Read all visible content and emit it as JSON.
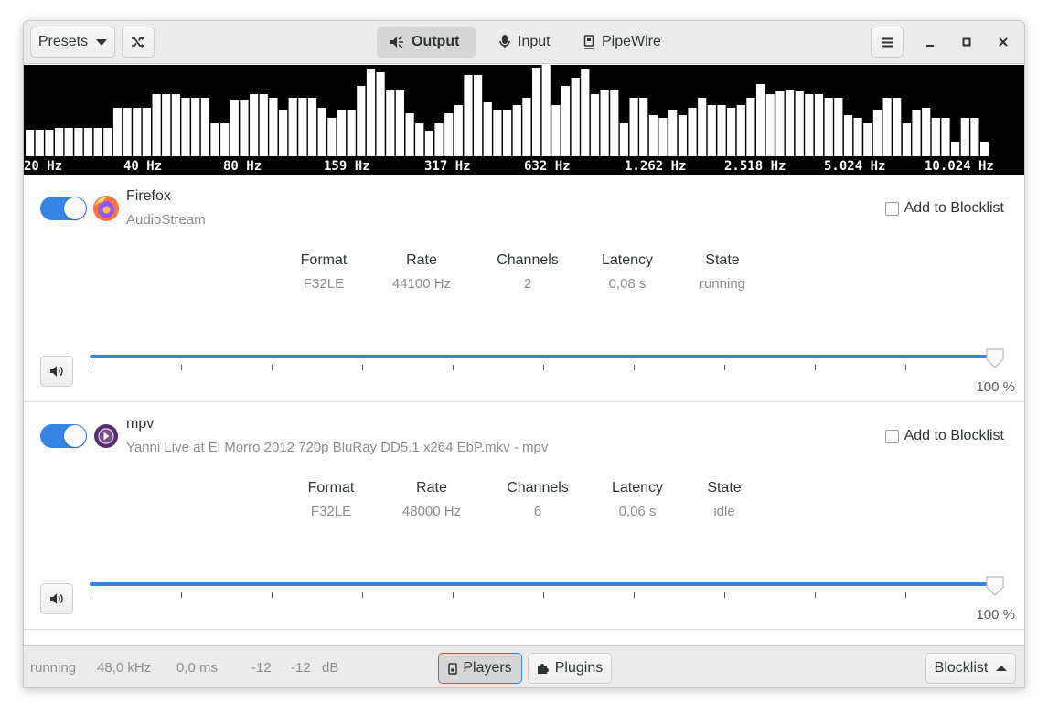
{
  "header": {
    "presets_label": "Presets",
    "tabs": [
      {
        "label": "Output",
        "icon": "speaker-icon",
        "active": true
      },
      {
        "label": "Input",
        "icon": "microphone-icon",
        "active": false
      },
      {
        "label": "PipeWire",
        "icon": "pipewire-icon",
        "active": false
      }
    ]
  },
  "spectrum": {
    "frequency_labels": [
      "20 Hz",
      "40 Hz",
      "80 Hz",
      "159 Hz",
      "317 Hz",
      "632 Hz",
      "1.262 Hz",
      "2.518 Hz",
      "5.024 Hz",
      "10.024 Hz"
    ],
    "levels": [
      0.29,
      0.29,
      0.29,
      0.31,
      0.31,
      0.31,
      0.31,
      0.31,
      0.31,
      0.53,
      0.53,
      0.53,
      0.53,
      0.68,
      0.68,
      0.68,
      0.64,
      0.64,
      0.64,
      0.36,
      0.36,
      0.62,
      0.62,
      0.68,
      0.68,
      0.64,
      0.51,
      0.64,
      0.64,
      0.64,
      0.53,
      0.42,
      0.51,
      0.51,
      0.77,
      0.95,
      0.92,
      0.73,
      0.73,
      0.47,
      0.36,
      0.28,
      0.36,
      0.47,
      0.56,
      0.89,
      0.89,
      0.59,
      0.51,
      0.51,
      0.56,
      0.64,
      0.97,
      1.0,
      0.56,
      0.77,
      0.86,
      0.95,
      0.68,
      0.73,
      0.73,
      0.36,
      0.64,
      0.64,
      0.45,
      0.42,
      0.51,
      0.45,
      0.53,
      0.64,
      0.56,
      0.56,
      0.53,
      0.56,
      0.64,
      0.79,
      0.68,
      0.71,
      0.73,
      0.71,
      0.68,
      0.68,
      0.64,
      0.64,
      0.45,
      0.42,
      0.36,
      0.51,
      0.64,
      0.64,
      0.36,
      0.51,
      0.53,
      0.42,
      0.42,
      0.16,
      0.42,
      0.42,
      0.16
    ],
    "bar_color": "#ffffff",
    "background": "#000000"
  },
  "streams": [
    {
      "enabled": true,
      "app_name": "Firefox",
      "media_name": "AudioStream",
      "icon": "firefox-icon",
      "blocklist_label": "Add to Blocklist",
      "info": [
        {
          "label": "Format",
          "value": "F32LE"
        },
        {
          "label": "Rate",
          "value": "44100 Hz"
        },
        {
          "label": "Channels",
          "value": "2"
        },
        {
          "label": "Latency",
          "value": "0,08 s"
        },
        {
          "label": "State",
          "value": "running"
        }
      ],
      "volume_text": "100 %",
      "volume": 1.0
    },
    {
      "enabled": true,
      "app_name": "mpv",
      "media_name": "Yanni Live at El Morro 2012 720p BluRay DD5.1 x264 EbP.mkv - mpv",
      "icon": "mpv-icon",
      "blocklist_label": "Add to Blocklist",
      "info": [
        {
          "label": "Format",
          "value": "F32LE"
        },
        {
          "label": "Rate",
          "value": "48000 Hz"
        },
        {
          "label": "Channels",
          "value": "6"
        },
        {
          "label": "Latency",
          "value": "0,06 s"
        },
        {
          "label": "State",
          "value": "idle"
        }
      ],
      "volume_text": "100 %",
      "volume": 1.0
    }
  ],
  "footer": {
    "state": "running",
    "rate": "48,0 kHz",
    "latency": "0,0 ms",
    "level_left": "-12",
    "level_right": "-12",
    "level_unit": "dB",
    "players_label": "Players",
    "plugins_label": "Plugins",
    "blocklist_label": "Blocklist"
  },
  "colors": {
    "accent": "#3584e4",
    "firefox_orange": "#ff7139",
    "mpv_purple": "#5a2d6e"
  }
}
